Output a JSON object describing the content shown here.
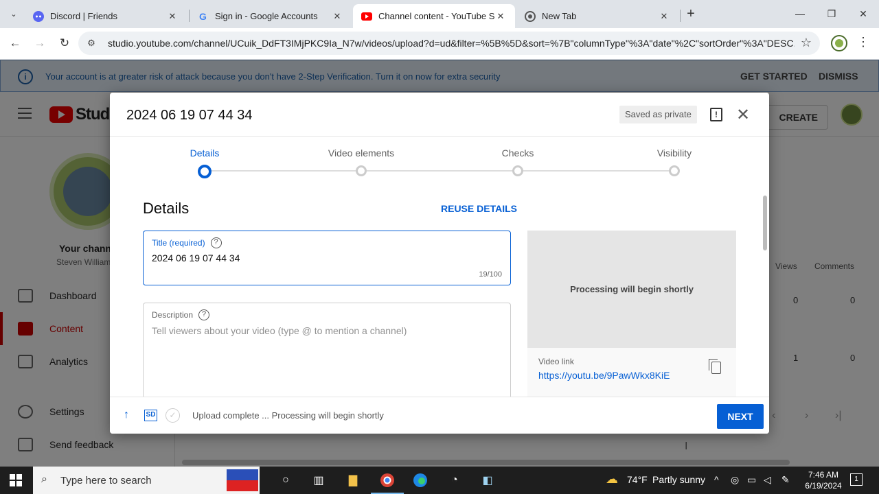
{
  "browser": {
    "tabs": [
      {
        "label": "Discord | Friends",
        "icon": "discord-icon",
        "active": false
      },
      {
        "label": "Sign in - Google Accounts",
        "icon": "google-icon",
        "active": false
      },
      {
        "label": "Channel content - YouTube Stu",
        "icon": "youtube-icon",
        "active": true
      },
      {
        "label": "New Tab",
        "icon": "chrome-icon",
        "active": false
      }
    ],
    "url": "studio.youtube.com/channel/UCuik_DdFT3IMjPKC9Ia_N7w/videos/upload?d=ud&filter=%5B%5D&sort=%7B\"columnType\"%3A\"date\"%2C\"sortOrder\"%3A\"DESC..."
  },
  "banner": {
    "message": "Your account is at greater risk of attack because you don't have 2-Step Verification. Turn it on now for extra security",
    "get_started": "GET STARTED",
    "dismiss": "DISMISS"
  },
  "studio": {
    "logo_text": "Studio",
    "create_label": "CREATE",
    "channel_name": "Your channel",
    "channel_owner": "Steven William",
    "nav": [
      {
        "label": "Dashboard"
      },
      {
        "label": "Content"
      },
      {
        "label": "Analytics"
      },
      {
        "label": "Settings"
      },
      {
        "label": "Send feedback"
      }
    ],
    "columns": {
      "views": "Views",
      "comments": "Comments"
    },
    "rows": [
      {
        "views": "0",
        "comments": "0"
      },
      {
        "views": "1",
        "comments": "0"
      }
    ]
  },
  "dialog": {
    "title": "2024 06 19 07 44 34",
    "saved_status": "Saved as private",
    "steps": [
      "Details",
      "Video elements",
      "Checks",
      "Visibility"
    ],
    "section_title": "Details",
    "reuse_label": "REUSE DETAILS",
    "title_field": {
      "label": "Title (required)",
      "value": "2024 06 19 07 44 34",
      "count": "19/100"
    },
    "description_field": {
      "label": "Description",
      "placeholder": "Tell viewers about your video (type @ to mention a channel)"
    },
    "preview_status": "Processing will begin shortly",
    "video_link_label": "Video link",
    "video_link": "https://youtu.be/9PawWkx8KiE",
    "footer_status": "Upload complete ... Processing will begin shortly",
    "sd_badge": "SD",
    "next_label": "NEXT"
  },
  "taskbar": {
    "search_placeholder": "Type here to search",
    "temperature": "74°F",
    "weather": "Partly sunny",
    "time": "7:46 AM",
    "date": "6/19/2024",
    "notification_count": "1"
  },
  "colors": {
    "accent": "#065fd4",
    "youtube_red": "#ff0000",
    "banner_bg": "#e6f0fb"
  }
}
